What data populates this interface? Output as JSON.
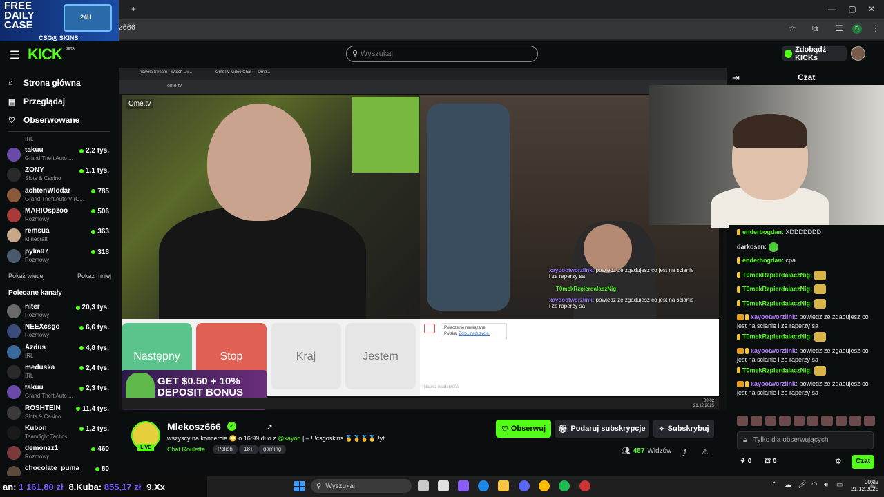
{
  "browser": {
    "url": "z666",
    "window_controls": [
      "—",
      "▢",
      "✕"
    ],
    "new_tab": "+",
    "profile_letter": "D"
  },
  "promo": {
    "text": "FREE\nDAILY\nCASE",
    "brand": "CSG◎ SKINS",
    "case_label": "24H"
  },
  "header": {
    "logo": "KICK",
    "beta": "BETA",
    "search_placeholder": "Wyszukaj",
    "kicks_button": "Zdobądź KICKs"
  },
  "sidebar": {
    "nav": [
      {
        "label": "Strona główna",
        "icon": "home-icon"
      },
      {
        "label": "Przeglądaj",
        "icon": "browse-icon"
      },
      {
        "label": "Obserwowane",
        "icon": "heart-icon"
      }
    ],
    "partial_category": "IRL",
    "followed": [
      {
        "name": "takuu",
        "category": "Grand Theft Auto ...",
        "viewers": "2,2 tys.",
        "color": "#6a4aa8"
      },
      {
        "name": "ZONY",
        "category": "Slots & Casino",
        "viewers": "1,1 tys.",
        "color": "#2a2a2a"
      },
      {
        "name": "achtenWlodar",
        "category": "Grand Theft Auto V (G...",
        "viewers": "785",
        "color": "#8a5a3a"
      },
      {
        "name": "MARIOspzoo",
        "category": "Rozmowy",
        "viewers": "506",
        "color": "#aa3a3a"
      },
      {
        "name": "remsua",
        "category": "Minecraft",
        "viewers": "363",
        "color": "#c9a88a"
      },
      {
        "name": "pyka97",
        "category": "Rozmowy",
        "viewers": "318",
        "color": "#4a5a6a"
      }
    ],
    "show_more": "Pokaż więcej",
    "show_less": "Pokaż mniej",
    "recommended_title": "Polecane kanały",
    "recommended": [
      {
        "name": "niter",
        "category": "Rozmowy",
        "viewers": "20,3 tys.",
        "color": "#6a6a6a"
      },
      {
        "name": "NEEXcsgo",
        "category": "Rozmowy",
        "viewers": "6,6 tys.",
        "color": "#3a4a7a"
      },
      {
        "name": "Azdus",
        "category": "IRL",
        "viewers": "4,8 tys.",
        "color": "#3a6a9a"
      },
      {
        "name": "meduska",
        "category": "IRL",
        "viewers": "2,4 tys.",
        "color": "#2a2a2a"
      },
      {
        "name": "takuu",
        "category": "Grand Theft Auto ...",
        "viewers": "2,3 tys.",
        "color": "#6a4aa8"
      },
      {
        "name": "ROSHTEIN",
        "category": "Slots & Casino",
        "viewers": "11,4 tys.",
        "color": "#3a3a3a"
      },
      {
        "name": "Kubon",
        "category": "Teamfight Tactics",
        "viewers": "1,2 tys.",
        "color": "#1a1a1a"
      },
      {
        "name": "demonzz1",
        "category": "Rozmowy",
        "viewers": "460",
        "color": "#7a3a3a"
      },
      {
        "name": "chocolate_puma",
        "category": "",
        "viewers": "80",
        "color": "#5a4a3a"
      }
    ]
  },
  "video": {
    "inner_tabs": [
      "noweła Stream - Watch Liv...",
      "OmeTV Video Chat — Ome..."
    ],
    "inner_url": "ome.tv",
    "ome_logo": "Ome.tv",
    "buttons": {
      "next": "Następny",
      "stop": "Stop",
      "country": "Kraj",
      "iam": "Jestem"
    },
    "ome_message_line1": "Połączenie nawiązane.",
    "ome_message_line2": "Polska.",
    "ome_report": "Zgłoś naduzycie.",
    "ome_input": "Napisz wiadomość",
    "deposit_line1": "GET $0.50 + 10%",
    "deposit_line2": "DEPOSIT BONUS",
    "overlay_chat": [
      {
        "user": "xayoootworzlink:",
        "text": "powiedz ze zgadujesz co jest na scianie",
        "cont": "i ze raperzy sa"
      },
      {
        "user": "T0mekRzpierdalaczNig:",
        "text": "",
        "cont": ""
      },
      {
        "user": "xayoootworzlink:",
        "text": "powiedz ze zgadujesz co jest na scianie",
        "cont": "i ze raperzy sa"
      }
    ],
    "inner_clock": "00:02\n21.12.2025"
  },
  "chat": {
    "title": "Czat",
    "messages": [
      {
        "user": "enderbogdan:",
        "text": "XDDDDDDD",
        "user_color": "#53fc18",
        "badge": "mod",
        "emotes": 0
      },
      {
        "user": "darkosen:",
        "text": "",
        "user_color": "#e6e6e6",
        "badge": "none",
        "emotes": 1
      },
      {
        "user": "enderbogdan:",
        "text": "cpa",
        "user_color": "#53fc18",
        "badge": "mod",
        "emotes": 0
      },
      {
        "user": "T0mekRzpierdalaczNig:",
        "text": "",
        "user_color": "#53fc18",
        "badge": "mod",
        "emotes": 2
      },
      {
        "user": "T0mekRzpierdalaczNig:",
        "text": "",
        "user_color": "#53fc18",
        "badge": "mod",
        "emotes": 2
      },
      {
        "user": "T0mekRzpierdalaczNig:",
        "text": "",
        "user_color": "#53fc18",
        "badge": "mod",
        "emotes": 2
      },
      {
        "user": "xayootworzlink:",
        "text": "powiedz ze zgadujesz co jest na scianie i ze raperzy sa",
        "user_color": "#b57bff",
        "badge": "sub",
        "emotes": 0
      },
      {
        "user": "T0mekRzpierdalaczNig:",
        "text": "",
        "user_color": "#53fc18",
        "badge": "mod",
        "emotes": 2
      },
      {
        "user": "xayootworzlink:",
        "text": "powiedz ze zgadujesz co jest na scianie i ze raperzy sa",
        "user_color": "#b57bff",
        "badge": "sub",
        "emotes": 0
      },
      {
        "user": "T0mekRzpierdalaczNig:",
        "text": "",
        "user_color": "#53fc18",
        "badge": "mod",
        "emotes": 2
      },
      {
        "user": "xayootworzlink:",
        "text": "powiedz ze zgadujesz co jest na scianie i ze raperzy sa",
        "user_color": "#b57bff",
        "badge": "sub",
        "emotes": 0
      }
    ],
    "input_placeholder": "Tylko dla obserwujących",
    "kicks_count": "0",
    "points_count": "0",
    "send": "Czat"
  },
  "channel": {
    "name": "Mlekosz666",
    "live": "LIVE",
    "title_before": "wszyscy na koncercie 😳 o 16:99 duo z ",
    "title_mention": "@xayoo",
    "title_after": " | – ! !csgoskins 🥇🥇🥇🥇 !yt",
    "category": "Chat Roulette",
    "tags": [
      "Polish",
      "18+",
      "gaming"
    ],
    "follow": "Obserwuj",
    "gift": "Podaruj subskrypcje",
    "subscribe": "Subskrybuj",
    "viewers": "457",
    "viewers_label": "Widzów"
  },
  "taskbar": {
    "ticker": [
      {
        "label": "an:",
        "amount": "1 161,80 zł"
      },
      {
        "label": "8.Kuba:",
        "amount": "855,17 zł"
      },
      {
        "label": "9.Xx",
        "amount": ""
      }
    ],
    "search": "Wyszukaj",
    "time": "00:02",
    "date": "21.12.2025"
  },
  "colors": {
    "accent": "#53fc18",
    "background": "#0b0e0f",
    "panel": "#24272c"
  }
}
